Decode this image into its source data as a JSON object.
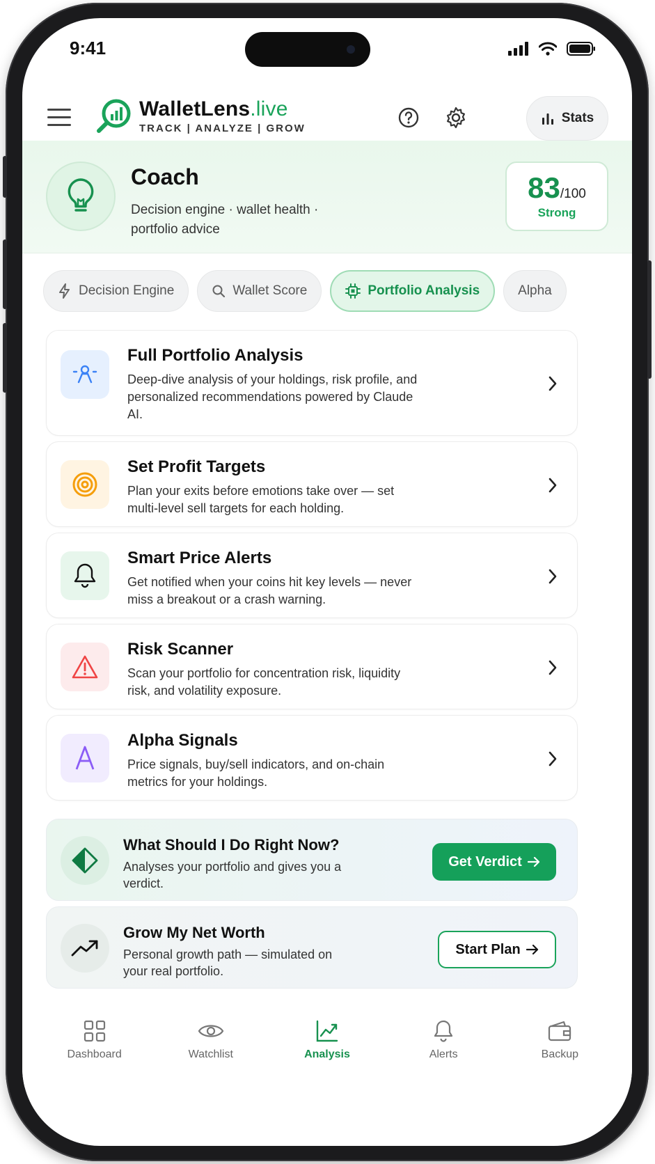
{
  "status": {
    "time": "9:41"
  },
  "header": {
    "brand_name": "WalletLens",
    "brand_tld": ".live",
    "tagline": "TRACK | ANALYZE | GROW",
    "stats_label": "Stats"
  },
  "hero": {
    "title": "Coach",
    "subtitle": "Decision engine · wallet health · portfolio advice",
    "score": "83",
    "score_max": "/100",
    "score_label": "Strong"
  },
  "tabs": [
    {
      "label": "Decision Engine",
      "icon": "bolt-icon"
    },
    {
      "label": "Wallet Score",
      "icon": "search-icon"
    },
    {
      "label": "Portfolio Analysis",
      "icon": "chip-icon",
      "active": true
    },
    {
      "label": "Alpha"
    }
  ],
  "cards": [
    {
      "title": "Full Portfolio Analysis",
      "description": "Deep-dive analysis of your holdings, risk profile, and personalized recommendations powered by Claude AI.",
      "icon": "person-scan-icon",
      "accent": "#3b82f6"
    },
    {
      "title": "Set Profit Targets",
      "description": "Plan your exits before emotions take over — set multi-level sell targets for each holding.",
      "icon": "target-icon",
      "accent": "#f59e0b"
    },
    {
      "title": "Smart Price Alerts",
      "description": "Get notified when your coins hit key levels — never miss a breakout or a crash warning.",
      "icon": "bell-icon",
      "accent": "#111111"
    },
    {
      "title": "Risk Scanner",
      "description": "Scan your portfolio for concentration risk, liquidity risk, and volatility exposure.",
      "icon": "warning-icon",
      "accent": "#ef4444"
    },
    {
      "title": "Alpha Signals",
      "description": "Price signals, buy/sell indicators, and on-chain metrics for your holdings.",
      "icon": "letter-a-icon",
      "accent": "#8b5cf6"
    }
  ],
  "actions": {
    "verdict": {
      "title": "What Should I Do Right Now?",
      "description": "Analyses your portfolio and gives you a verdict.",
      "button": "Get Verdict"
    },
    "grow": {
      "title": "Grow My Net Worth",
      "description": "Personal growth path — simulated on your real portfolio.",
      "button": "Start Plan"
    }
  },
  "nav": [
    {
      "label": "Dashboard",
      "icon": "grid-icon"
    },
    {
      "label": "Watchlist",
      "icon": "eye-icon"
    },
    {
      "label": "Analysis",
      "icon": "chart-line-icon",
      "active": true
    },
    {
      "label": "Alerts",
      "icon": "bell-icon"
    },
    {
      "label": "Backup",
      "icon": "wallet-icon"
    }
  ],
  "colors": {
    "brand_green": "#1aa35a",
    "primary_button": "#15a05a"
  }
}
